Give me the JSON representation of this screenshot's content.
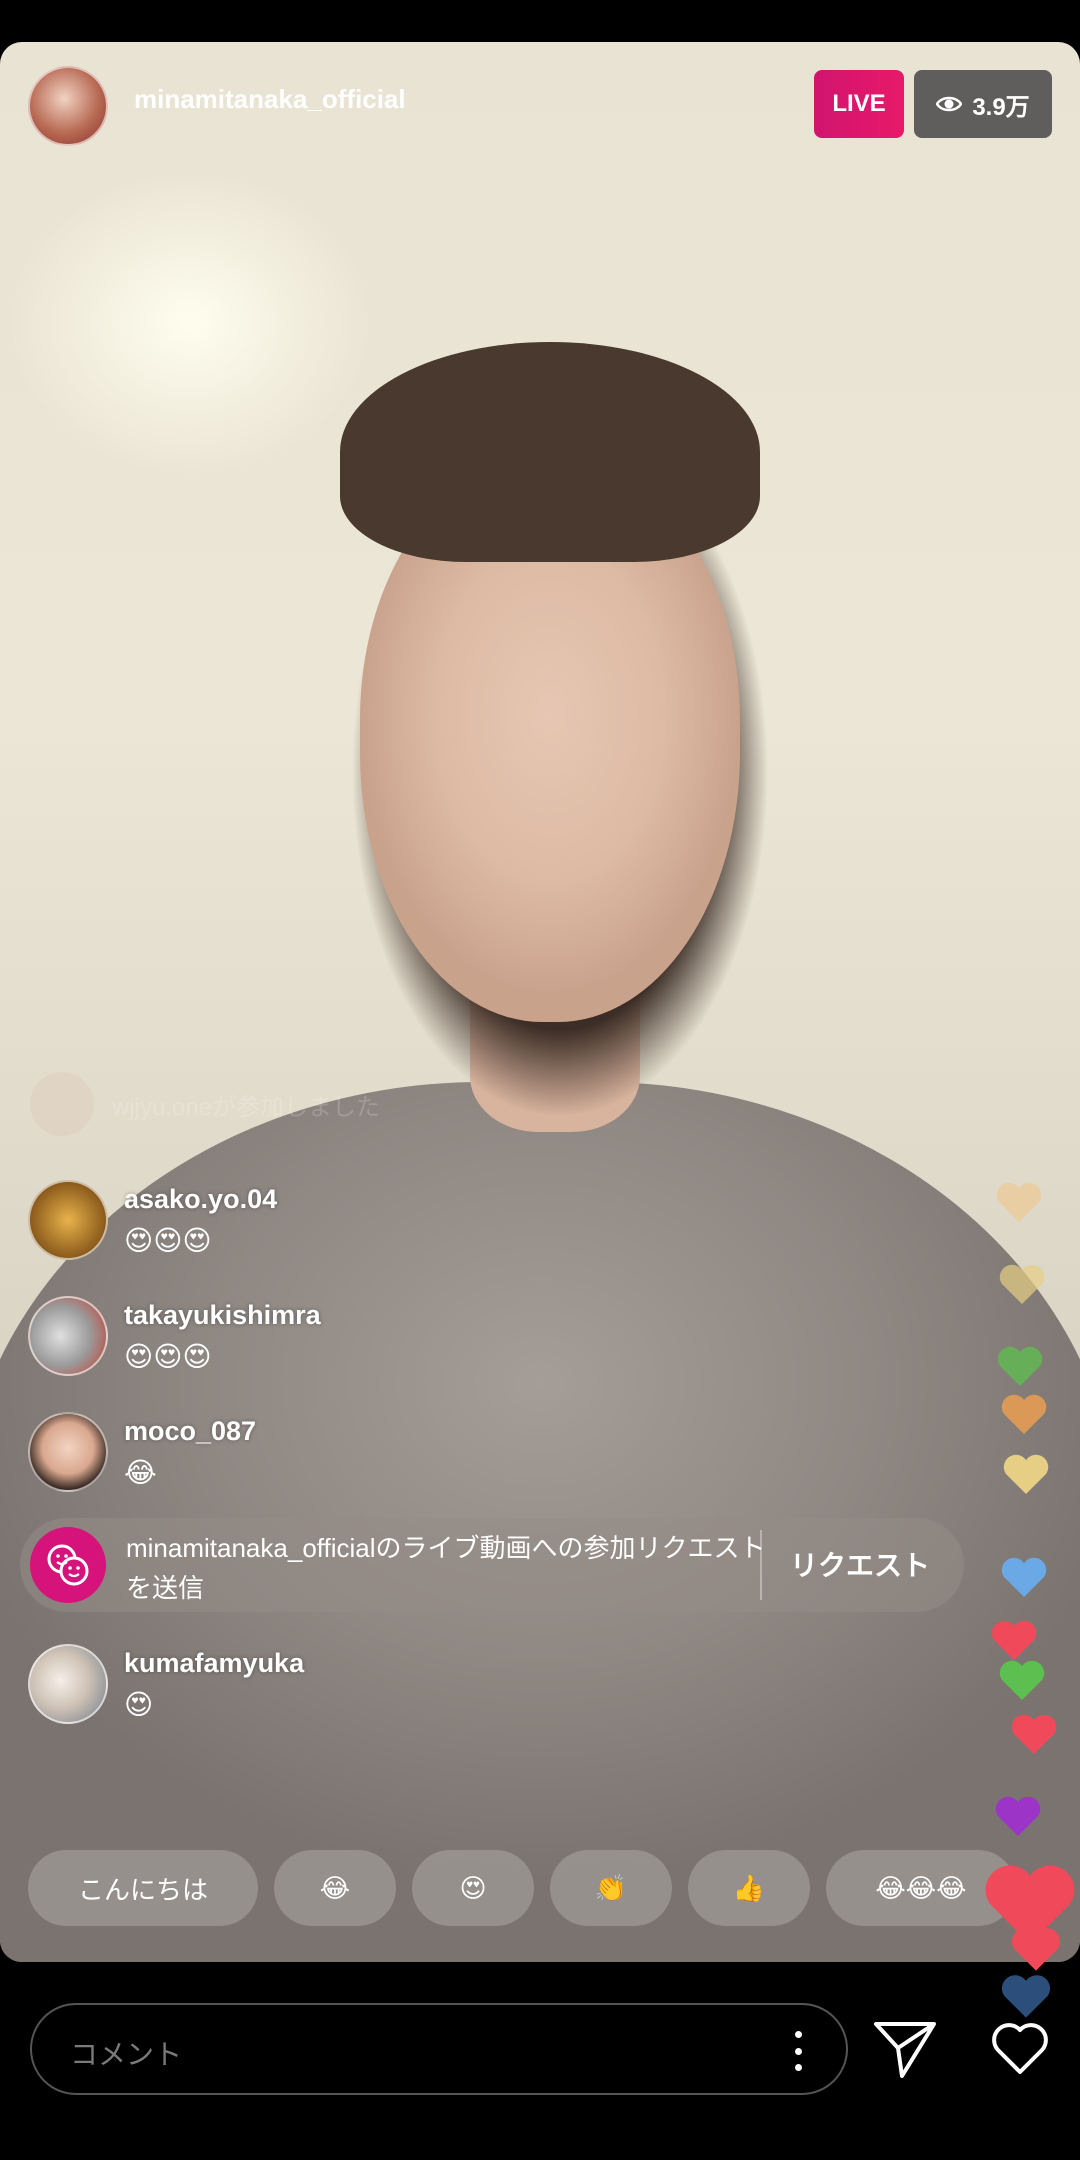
{
  "header": {
    "host_username": "minamitanaka_official",
    "live_label": "LIVE",
    "viewer_count": "3.9万"
  },
  "comments": {
    "joined_notice": "wjjyu.oneが参加しました",
    "items": [
      {
        "username": "asako.yo.04",
        "text": "😍😍😍"
      },
      {
        "username": "takayukishimra",
        "text": "😍😍😍"
      },
      {
        "username": "moco_087",
        "text": "😂"
      },
      {
        "username": "kumafamyuka",
        "text": "😍"
      }
    ]
  },
  "request_banner": {
    "text": "minamitanaka_officialのライブ動画への参加リクエストを送信",
    "button_label": "リクエスト"
  },
  "quick_replies": [
    "こんにちは",
    "😂",
    "😍",
    "👏",
    "👍",
    "😂😂😂"
  ],
  "bottom_bar": {
    "comment_placeholder": "コメント"
  },
  "colors": {
    "live_badge": "#e8196a",
    "request_icon": "#d5137a",
    "hearts": [
      "#f0c78a",
      "#e6cf85",
      "#5dbf4f",
      "#f1a04f",
      "#6aa9e6",
      "#9b34c7",
      "#f04a5a",
      "#2b4f7a"
    ]
  }
}
